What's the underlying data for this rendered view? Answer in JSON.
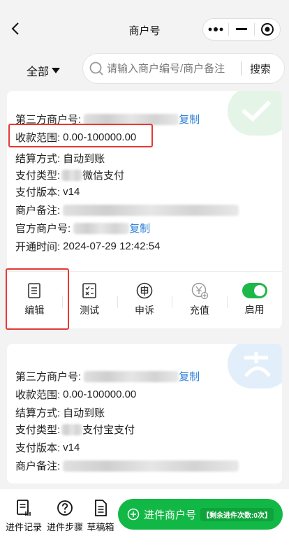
{
  "nav": {
    "title": "商户号"
  },
  "toolbar": {
    "filter_label": "全部",
    "search_placeholder": "请输入商户编号/商户备注",
    "search_label": "搜索"
  },
  "card1": {
    "third_party_label": "第三方商户号:",
    "copy_label": "复制",
    "range_label": "收款范围:",
    "range_value": "0.00-100000.00",
    "settle_label": "结算方式:",
    "settle_value": "自动到账",
    "paytype_label": "支付类型:",
    "paytype_value": "微信支付",
    "version_label": "支付版本:",
    "version_value": "v14",
    "remark_label": "商户备注:",
    "official_label": "官方商户号:",
    "official_copy": "复制",
    "opened_label": "开通时间:",
    "opened_value": "2024-07-29 12:42:54",
    "actions": [
      "编辑",
      "测试",
      "申诉",
      "充值",
      "启用"
    ],
    "enabled": true
  },
  "card2": {
    "third_party_label": "第三方商户号:",
    "copy_label": "复制",
    "range_label": "收款范围:",
    "range_value": "0.00-100000.00",
    "settle_label": "结算方式:",
    "settle_value": "自动到账",
    "paytype_label": "支付类型:",
    "paytype_value": "支付宝支付",
    "version_label": "支付版本:",
    "version_value": "v14",
    "remark_label": "商户备注:"
  },
  "bottom": {
    "records": "进件记录",
    "steps": "进件步骤",
    "drafts": "草稿箱",
    "primary_label": "进件商户号",
    "remaining": "【剩余进件次数:0次】"
  },
  "colors": {
    "accent": "#12b845",
    "link": "#2b7fd8",
    "highlight": "#e53935"
  }
}
